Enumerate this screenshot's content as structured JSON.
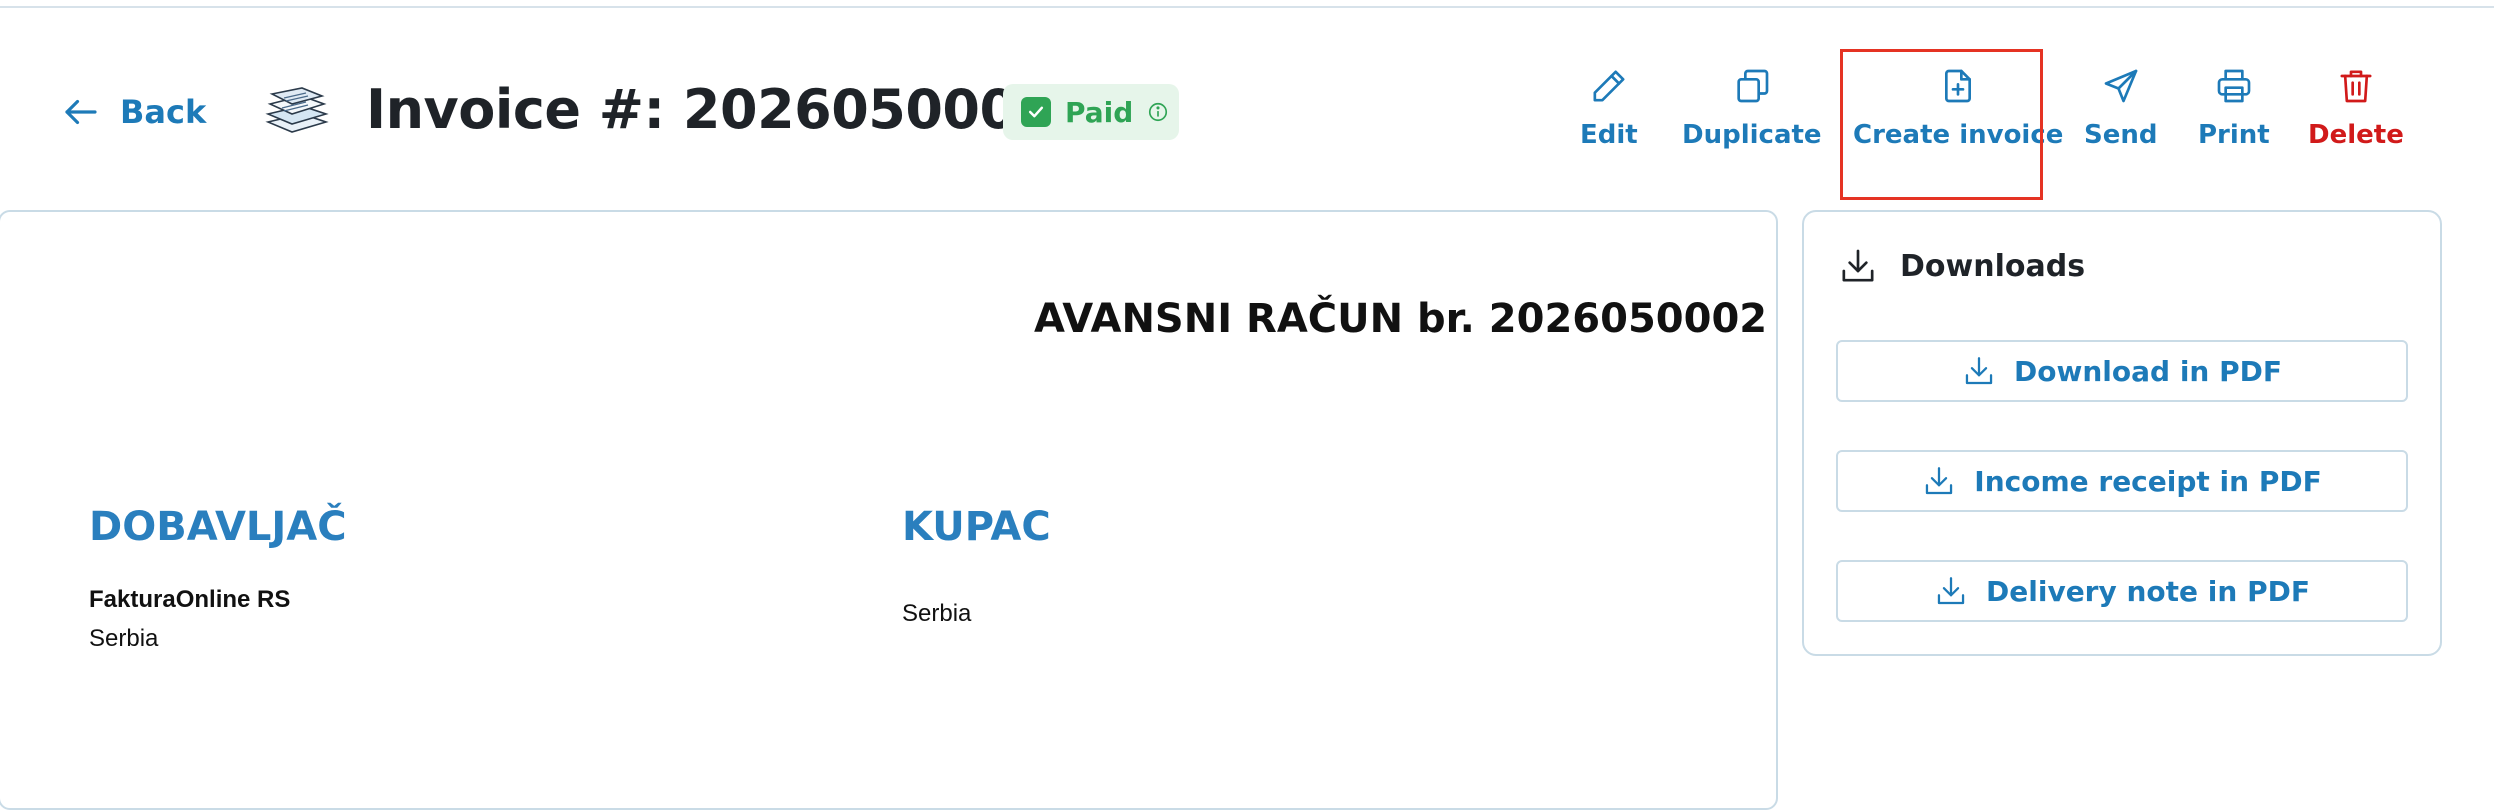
{
  "header": {
    "back_label": "Back",
    "title": "Invoice #: 2026050002",
    "status": "Paid"
  },
  "actions": [
    {
      "label": "Edit",
      "icon": "pencil-icon"
    },
    {
      "label": "Duplicate",
      "icon": "duplicate-icon"
    },
    {
      "label": "Create invoice",
      "icon": "file-plus-icon"
    },
    {
      "label": "Send",
      "icon": "send-icon"
    },
    {
      "label": "Print",
      "icon": "printer-icon"
    },
    {
      "label": "Delete",
      "icon": "trash-icon"
    }
  ],
  "document": {
    "title": "AVANSNI RAČUN br. 2026050002",
    "supplier": {
      "heading": "DOBAVLJAČ",
      "name": "FakturaOnline RS",
      "country": "Serbia"
    },
    "buyer": {
      "heading": "KUPAC",
      "country": "Serbia"
    }
  },
  "downloads": {
    "heading": "Downloads",
    "buttons": [
      {
        "label": "Download in PDF"
      },
      {
        "label": "Income receipt in PDF"
      },
      {
        "label": "Delivery note in PDF"
      }
    ]
  },
  "colors": {
    "accent": "#1d7ab8",
    "danger": "#d11a1a",
    "success": "#2fa455",
    "highlight": "#e53323"
  }
}
